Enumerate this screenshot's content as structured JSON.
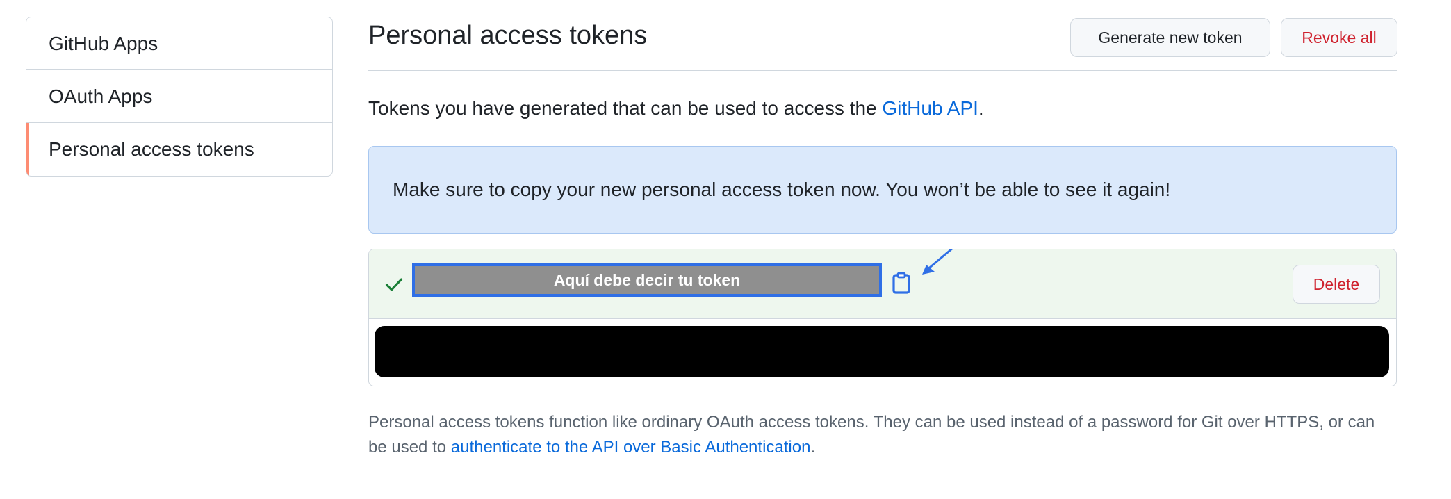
{
  "sidebar": {
    "items": [
      {
        "label": "GitHub Apps"
      },
      {
        "label": "OAuth Apps"
      },
      {
        "label": "Personal access tokens"
      }
    ]
  },
  "header": {
    "title": "Personal access tokens",
    "generate_label": "Generate new token",
    "revoke_label": "Revoke all"
  },
  "intro": {
    "text": "Tokens you have generated that can be used to access the ",
    "link": "GitHub API",
    "suffix": "."
  },
  "flash": {
    "message": "Make sure to copy your new personal access token now. You won’t be able to see it again!"
  },
  "token": {
    "value_overlay": "Aquí debe decir tu token",
    "delete_label": "Delete",
    "check_icon": "check-icon",
    "copy_icon": "clipboard-icon",
    "annotation_icon": "arrow-icon"
  },
  "note": {
    "text": "Personal access tokens function like ordinary OAuth access tokens. They can be used instead of a password for Git over HTTPS, or can be used to ",
    "link": "authenticate to the API over Basic Authentication",
    "suffix": "."
  },
  "colors": {
    "accent_link": "#0969da",
    "danger": "#cf222e",
    "flash_bg": "#dbe9fb",
    "token_row_bg": "#eef7ee",
    "active_indicator": "#fd8c73",
    "annotation_blue": "#2f6fe6"
  }
}
